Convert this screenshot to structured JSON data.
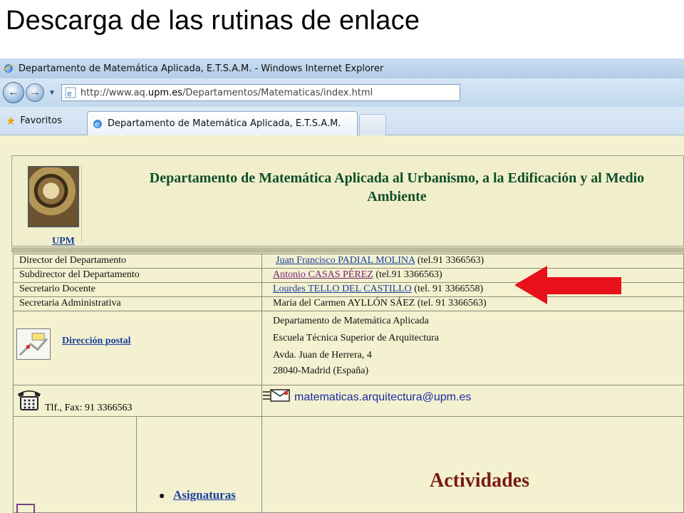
{
  "slide": {
    "title": "Descarga de las rutinas de enlace"
  },
  "browser": {
    "window_title": "Departamento de Matemática Aplicada, E.T.S.A.M. - Windows Internet Explorer",
    "url_prefix": "http://www.aq.",
    "url_host": "upm.es",
    "url_path": "/Departamentos/Matematicas/index.html",
    "favorites_label": "Favoritos",
    "tab_title": "Departamento de Matemática Aplicada, E.T.S.A.M.",
    "icons": [
      "ie-icon",
      "back-icon",
      "forward-icon",
      "dropdown-icon",
      "favorites-star-icon",
      "new-tab-icon"
    ]
  },
  "page": {
    "logo_link": "UPM",
    "dept_title_line1": "Departamento de Matemática Aplicada al Urbanismo, a la Edificación y al Medio",
    "dept_title_line2": "Ambiente",
    "staff": [
      {
        "role": "Director del Departamento",
        "name": "Juan Francisco PADIAL MOLINA",
        "tel": " (tel.91 3366563)"
      },
      {
        "role": "Subdirector del Departamento",
        "name": "Antonio CASAS PÉREZ",
        "tel": " (tel.91 3366563)"
      },
      {
        "role": "Secretario Docente",
        "name": "Lourdes TELLO DEL CASTILLO",
        "tel": " (tel. 91 3366558)"
      },
      {
        "role": "Secretaria Administrativa",
        "name": "Maria del Carmen AYLLÓN SÁEZ (tel. 91 3366563)",
        "tel": ""
      }
    ],
    "postal_link": "Dirección postal",
    "address": [
      "Departamento de Matemática Aplicada",
      "Escuela Técnica Superior de Arquitectura",
      "Avda. Juan de Herrera, 4",
      "28040-Madrid (España)"
    ],
    "phone_fax": "Tlf., Fax: 91 3366563",
    "email": "matematicas.arquitectura@upm.es",
    "asignaturas": "Asignaturas",
    "actividades": "Actividades"
  },
  "colors": {
    "page_bg": "#f3f1cf",
    "link": "#1a3fa0",
    "visited_link": "#7a1f7a",
    "dept_title": "#0e4f2a",
    "actividades": "#7a1b12",
    "arrow": "#e8101a"
  }
}
